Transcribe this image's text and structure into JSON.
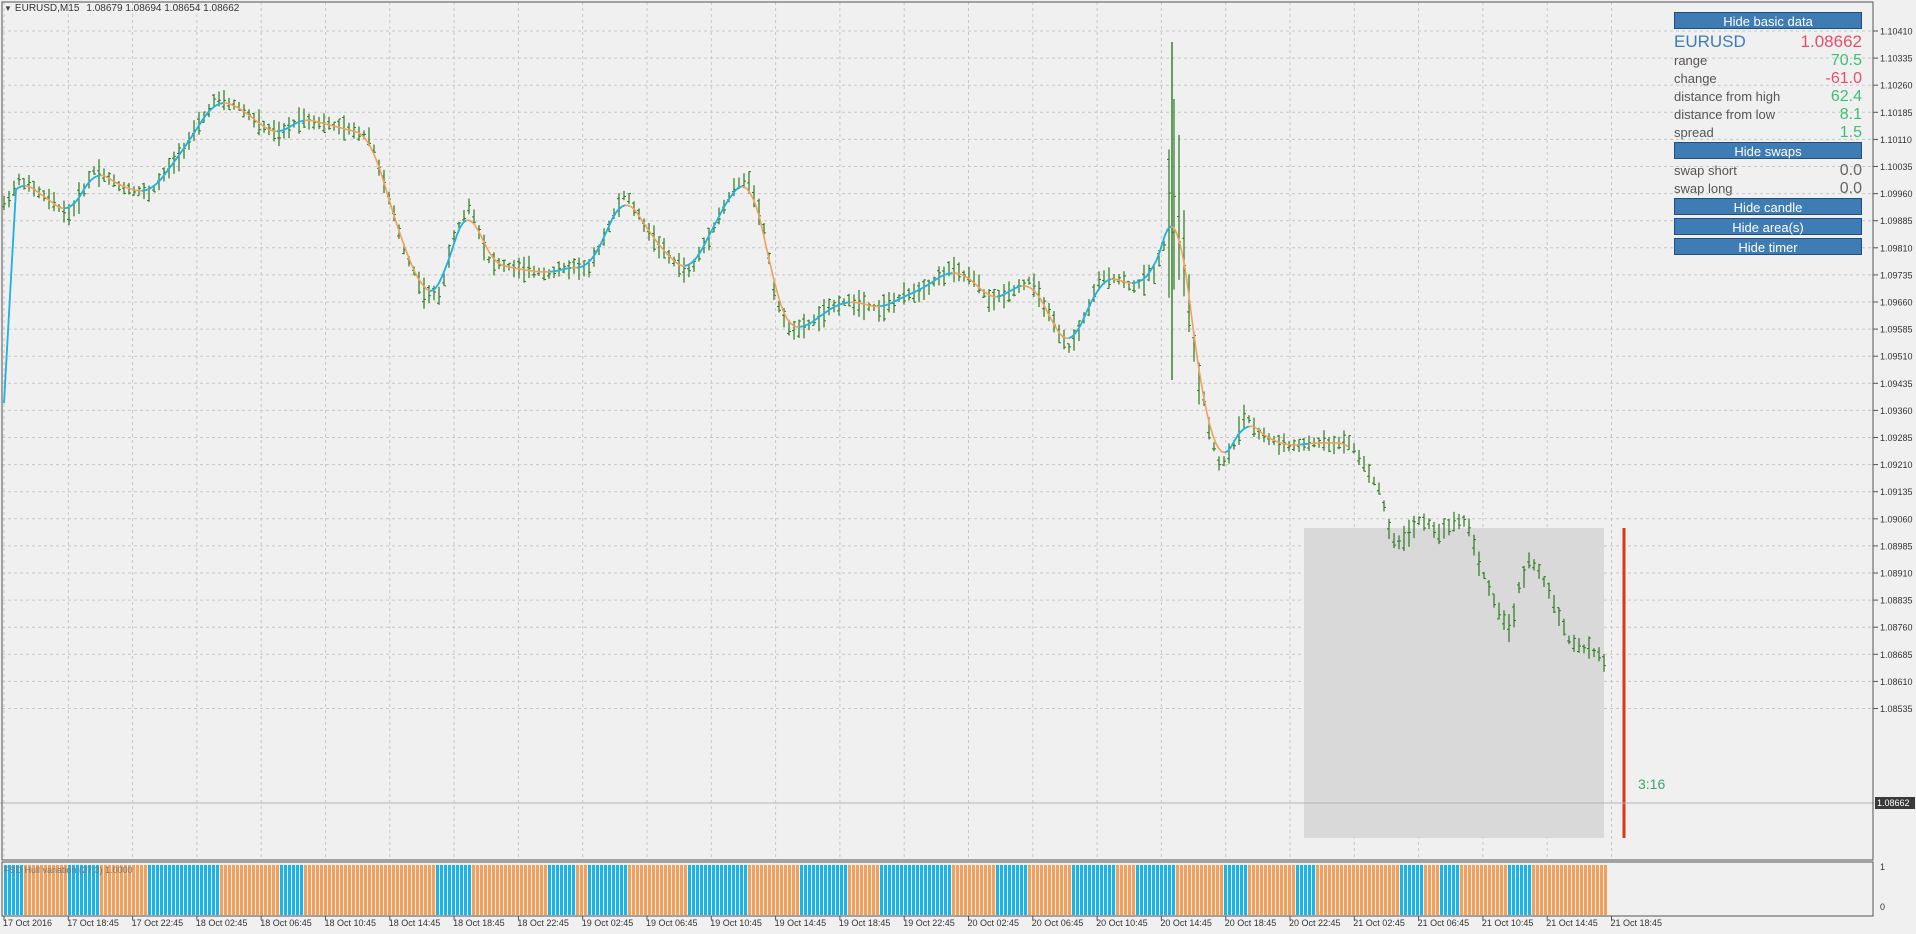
{
  "chart": {
    "symbol_timeframe": "EURUSD,M15",
    "ohlc": "1.08679 1.08694 1.08654 1.08662",
    "current_price_tag": "1.08662",
    "timer": "3:16",
    "price_labels": [
      "1.10410",
      "1.10335",
      "1.10260",
      "1.10185",
      "1.10110",
      "1.10035",
      "1.09960",
      "1.09885",
      "1.09810",
      "1.09735",
      "1.09660",
      "1.09585",
      "1.09510",
      "1.09435",
      "1.09360",
      "1.09285",
      "1.09210",
      "1.09135",
      "1.09060",
      "1.08985",
      "1.08910",
      "1.08835",
      "1.08760",
      "1.08685",
      "1.08610",
      "1.08535"
    ],
    "time_labels": [
      "17 Oct 2016",
      "17 Oct 18:45",
      "17 Oct 22:45",
      "18 Oct 02:45",
      "18 Oct 06:45",
      "18 Oct 10:45",
      "18 Oct 14:45",
      "18 Oct 18:45",
      "18 Oct 22:45",
      "19 Oct 02:45",
      "19 Oct 06:45",
      "19 Oct 10:45",
      "19 Oct 14:45",
      "19 Oct 18:45",
      "19 Oct 22:45",
      "20 Oct 02:45",
      "20 Oct 06:45",
      "20 Oct 10:45",
      "20 Oct 14:45",
      "20 Oct 18:45",
      "20 Oct 22:45",
      "21 Oct 02:45",
      "21 Oct 06:45",
      "21 Oct 10:45",
      "21 Oct 14:45",
      "21 Oct 18:45"
    ],
    "indicator_label": "FSD Hull variation (27,3) 1.0000",
    "indicator_scale": [
      "1",
      "0"
    ],
    "colors": {
      "bars": "#2a7a1e",
      "hull_up": "#1ab4ea",
      "hull_down": "#f2a05a",
      "area_fill": "#d9d9d9",
      "range_line": "#d93a14",
      "grid": "#c8c8c8",
      "background": "#f0f0f0"
    }
  },
  "panel": {
    "hide_basic_data": "Hide basic data",
    "symbol": "EURUSD",
    "price": "1.08662",
    "rows": [
      {
        "label": "range",
        "value": "70.5"
      },
      {
        "label": "change",
        "value": "-61.0"
      },
      {
        "label": "distance from high",
        "value": "62.4"
      },
      {
        "label": "distance from low",
        "value": "8.1"
      },
      {
        "label": "spread",
        "value": "1.5"
      }
    ],
    "hide_swaps": "Hide swaps",
    "swaps": [
      {
        "label": "swap short",
        "value": "0.0"
      },
      {
        "label": "swap long",
        "value": "0.0"
      }
    ],
    "hide_candle": "Hide candle",
    "hide_areas": "Hide area(s)",
    "hide_timer": "Hide timer"
  }
}
